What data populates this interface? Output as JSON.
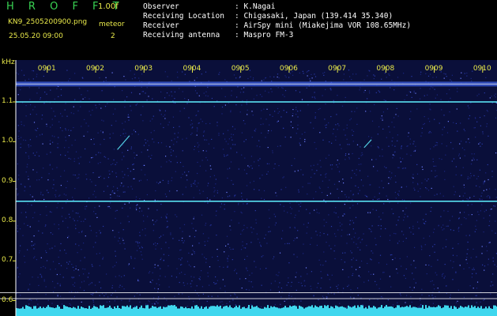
{
  "header": {
    "app_title": "H R O F F T",
    "version": "1.00f",
    "filename": "KN9_2505200900.png",
    "mode": "meteor",
    "datetime": "25.05.20 09:00",
    "count": "2"
  },
  "meta": [
    {
      "label": "Observer",
      "value": ": K.Nagai"
    },
    {
      "label": "Receiving Location",
      "value": ": Chigasaki, Japan (139.414 35.340)"
    },
    {
      "label": "Receiver",
      "value": ": AirSpy mini (Miakejima VOR 108.65MHz)"
    },
    {
      "label": "Receiving antenna",
      "value": ": Maspro FM-3"
    }
  ],
  "colors": {
    "background": "#0a0f3a",
    "label": "#e8e84a",
    "signal": "#5ff0ff",
    "marker": "#ffffff"
  },
  "chart_data": {
    "type": "heatmap",
    "title": "",
    "y_unit": "kHz",
    "y_ticks": [
      "1.1",
      "1.0",
      "0.9",
      "0.8",
      "0.7",
      "0.6"
    ],
    "y_tick_values": [
      1.1,
      1.0,
      0.9,
      0.8,
      0.7,
      0.6
    ],
    "ylim": [
      0.585,
      1.16
    ],
    "x_ticks": [
      "0901",
      "0902",
      "0903",
      "0904",
      "0905",
      "0906",
      "0907",
      "0908",
      "0909",
      "0910"
    ],
    "x_tick_values": [
      1,
      2,
      3,
      4,
      5,
      6,
      7,
      8,
      9,
      10
    ],
    "xlim": [
      0.35,
      10.15
    ],
    "carrier_lines_khz": [
      1.1,
      0.85
    ],
    "top_band_khz": 1.145,
    "marker_lines_khz": [
      0.62,
      0.605
    ],
    "meteor_echoes": [
      {
        "start_min": 2.45,
        "end_min": 2.7,
        "freq_start_khz": 0.98,
        "freq_end_khz": 1.015
      },
      {
        "start_min": 7.55,
        "end_min": 7.7,
        "freq_start_khz": 0.985,
        "freq_end_khz": 1.005
      }
    ]
  }
}
